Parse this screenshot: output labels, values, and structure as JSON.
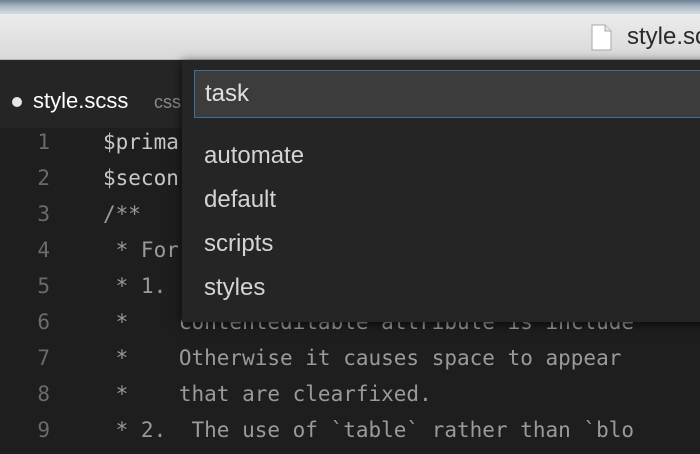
{
  "window": {
    "title": "style.scss"
  },
  "tab": {
    "name": "style.scss",
    "language": "css"
  },
  "quick_open": {
    "query": "task",
    "items": [
      "automate",
      "default",
      "scripts",
      "styles"
    ]
  },
  "editor": {
    "lines": [
      {
        "num": "1",
        "text": "$prima"
      },
      {
        "num": "2",
        "text": "$secon"
      },
      {
        "num": "3",
        "text": "/**"
      },
      {
        "num": "4",
        "text": " * For"
      },
      {
        "num": "5",
        "text": " * 1."
      },
      {
        "num": "6",
        "text": " *    contenteditable attribute is include"
      },
      {
        "num": "7",
        "text": " *    Otherwise it causes space to appear"
      },
      {
        "num": "8",
        "text": " *    that are clearfixed."
      },
      {
        "num": "9",
        "text": " * 2.  The use of `table` rather than `blo"
      }
    ]
  }
}
